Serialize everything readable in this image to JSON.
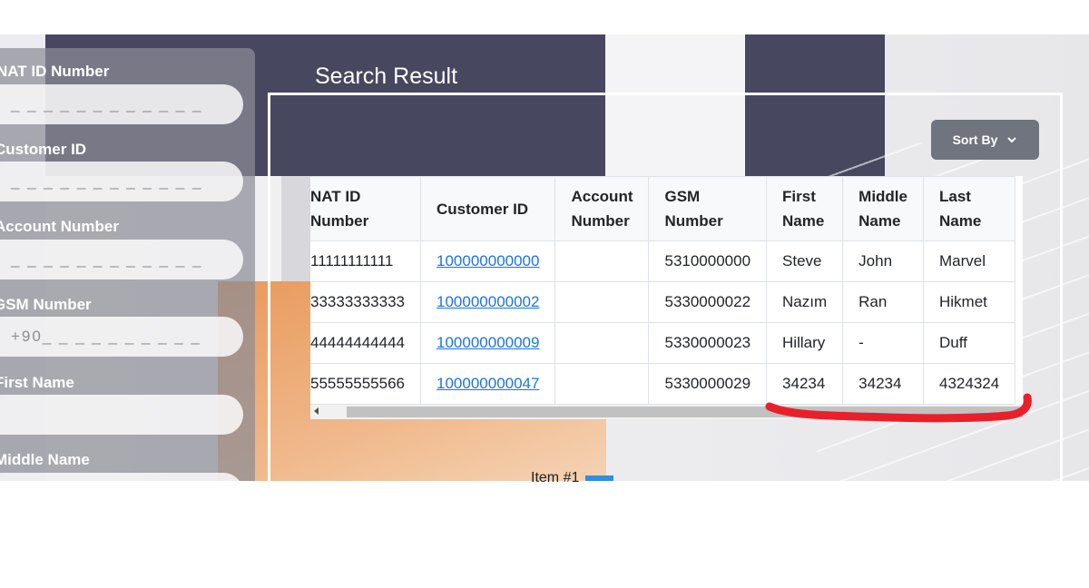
{
  "sidebar": {
    "fields": [
      {
        "label": "NAT ID Number",
        "value": "_ _ _ _ _ _ _ _ _ _ _ _"
      },
      {
        "label": "Customer ID",
        "value": "_ _ _ _ _ _ _ _ _ _ _ _"
      },
      {
        "label": "Account Number",
        "value": "_ _ _ _ _ _ _ _ _ _ _ _"
      },
      {
        "label": "GSM Number",
        "value": "+90_ _ _ _ _ _ _ _ _ _"
      },
      {
        "label": "First Name",
        "value": ""
      },
      {
        "label": "Middle Name",
        "value": ""
      }
    ]
  },
  "results": {
    "title": "Search Result",
    "sort_label": "Sort By",
    "columns": [
      "NAT ID Number",
      "Customer ID",
      "Account Number",
      "GSM Number",
      "First Name",
      "Middle Name",
      "Last Name"
    ],
    "column_headers": {
      "nat_id": [
        "NAT ID",
        "Number"
      ],
      "customer_id": "Customer ID",
      "account": [
        "Account",
        "Number"
      ],
      "gsm": [
        "GSM",
        "Number"
      ],
      "first": [
        "First",
        "Name"
      ],
      "middle": [
        "Middle",
        "Name"
      ],
      "last": [
        "Last",
        "Name"
      ]
    },
    "rows": [
      {
        "nat_id": "11111111111",
        "customer_id": "100000000000",
        "account": "",
        "gsm": "5310000000",
        "first": "Steve",
        "middle": "John",
        "last": "Marvel"
      },
      {
        "nat_id": "33333333333",
        "customer_id": "100000000002",
        "account": "",
        "gsm": "5330000022",
        "first": "Nazım",
        "middle": "Ran",
        "last": "Hikmet"
      },
      {
        "nat_id": "44444444444",
        "customer_id": "100000000009",
        "account": "",
        "gsm": "5330000023",
        "first": "Hillary",
        "middle": "-",
        "last": "Duff"
      },
      {
        "nat_id": "55555555566",
        "customer_id": "100000000047",
        "account": "",
        "gsm": "5330000029",
        "first": "34234",
        "middle": "34234",
        "last": "4324324"
      }
    ]
  },
  "footer": {
    "item_label": "Item #1"
  },
  "colors": {
    "annotation": "#e8202a",
    "link": "#1a73e8",
    "sort_button": "#6f747e"
  },
  "icons": {
    "sort": "chevron-down-icon"
  }
}
